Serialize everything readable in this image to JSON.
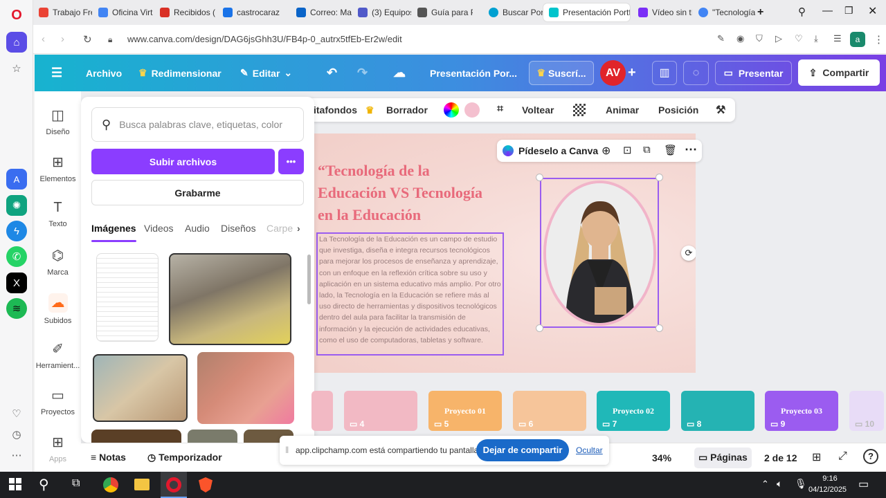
{
  "browser": {
    "tabs": [
      {
        "label": "Trabajo Fre",
        "color": "#ea4335"
      },
      {
        "label": "Oficina Virt",
        "color": "#4285f4"
      },
      {
        "label": "Recibidos (",
        "color": "#d93025"
      },
      {
        "label": "castrocaraz",
        "color": "#1a73e8"
      },
      {
        "label": "Correo: Ma",
        "color": "#0a64c8"
      },
      {
        "label": "(3) Equipos",
        "color": "#5059c9"
      },
      {
        "label": "Guía para P",
        "color": "#555555"
      },
      {
        "label": "Buscar Port",
        "color": "#00a0d1"
      },
      {
        "label": "Presentación Portfo",
        "color": "#00c4cc"
      },
      {
        "label": "Vídeo sin tí",
        "color": "#7b2ff7"
      },
      {
        "label": "\"Tecnología",
        "color": "#4285f4"
      }
    ],
    "url": "www.canva.com/design/DAG6jsGhh3U/FB4p-0_autrx5tfEb-Er2w/edit"
  },
  "header": {
    "archivo": "Archivo",
    "redimensionar": "Redimensionar",
    "editar": "Editar",
    "doc_title": "Presentación Por...",
    "suscribir": "Suscrí...",
    "avatar": "AV",
    "presentar": "Presentar",
    "compartir": "Compartir"
  },
  "nav": [
    {
      "label": "Diseño",
      "icon": "layout-icon"
    },
    {
      "label": "Elementos",
      "icon": "shapes-icon"
    },
    {
      "label": "Texto",
      "icon": "text-icon"
    },
    {
      "label": "Marca",
      "icon": "brand-icon"
    },
    {
      "label": "Subidos",
      "icon": "cloud-upload-icon"
    },
    {
      "label": "Herramient...",
      "icon": "tools-icon"
    },
    {
      "label": "Proyectos",
      "icon": "folder-icon"
    },
    {
      "label": "Apps",
      "icon": "apps-icon"
    }
  ],
  "panel": {
    "search_placeholder": "Busca palabras clave, etiquetas, color",
    "upload": "Subir archivos",
    "record": "Grabarme",
    "tabs": [
      "Imágenes",
      "Videos",
      "Audio",
      "Diseños",
      "Carpe"
    ]
  },
  "toolbar": {
    "quitafondos": "itafondos",
    "borrador": "Borrador",
    "voltear": "Voltear",
    "animar": "Animar",
    "posicion": "Posición"
  },
  "element_popup": {
    "ask": "Pídeselo a Canva"
  },
  "slide": {
    "title": "“Tecnología de la Educación VS Tecnología en la Educación",
    "body": "La Tecnología de la Educación es un campo de estudio que investiga, diseña e integra recursos tecnológicos para mejorar los procesos de enseñanza y aprendizaje, con un enfoque en la reflexión crítica sobre su uso y aplicación en un sistema educativo más amplio. Por otro lado, la Tecnología en la Educación se refiere más al uso directo de herramientas y dispositivos tecnológicos dentro del aula para facilitar la transmisión de información y la ejecución de actividades educativas, como el uso de computadoras, tabletas y software."
  },
  "pages": [
    {
      "num": "4",
      "title": "",
      "bg": "#f2b9c4"
    },
    {
      "num": "5",
      "title": "Proyecto 01",
      "bg": "#f7b46a"
    },
    {
      "num": "6",
      "title": "",
      "bg": "#f6c59a"
    },
    {
      "num": "7",
      "title": "Proyecto 02",
      "bg": "#20b8b8"
    },
    {
      "num": "8",
      "title": "",
      "bg": "#25b3b3"
    },
    {
      "num": "9",
      "title": "Proyecto 03",
      "bg": "#9b5cf0"
    },
    {
      "num": "10",
      "title": "",
      "bg": "#e8dcf7"
    }
  ],
  "bottom": {
    "notas": "Notas",
    "temporizador": "Temporizador",
    "zoom": "34%",
    "paginas": "Páginas",
    "page_count": "2 de 12"
  },
  "share_bar": {
    "text": "app.clipchamp.com está compartiendo tu pantalla.",
    "stop": "Dejar de compartir",
    "hide": "Ocultar"
  },
  "taskbar": {
    "time": "9:16",
    "date": "04/12/2025"
  }
}
